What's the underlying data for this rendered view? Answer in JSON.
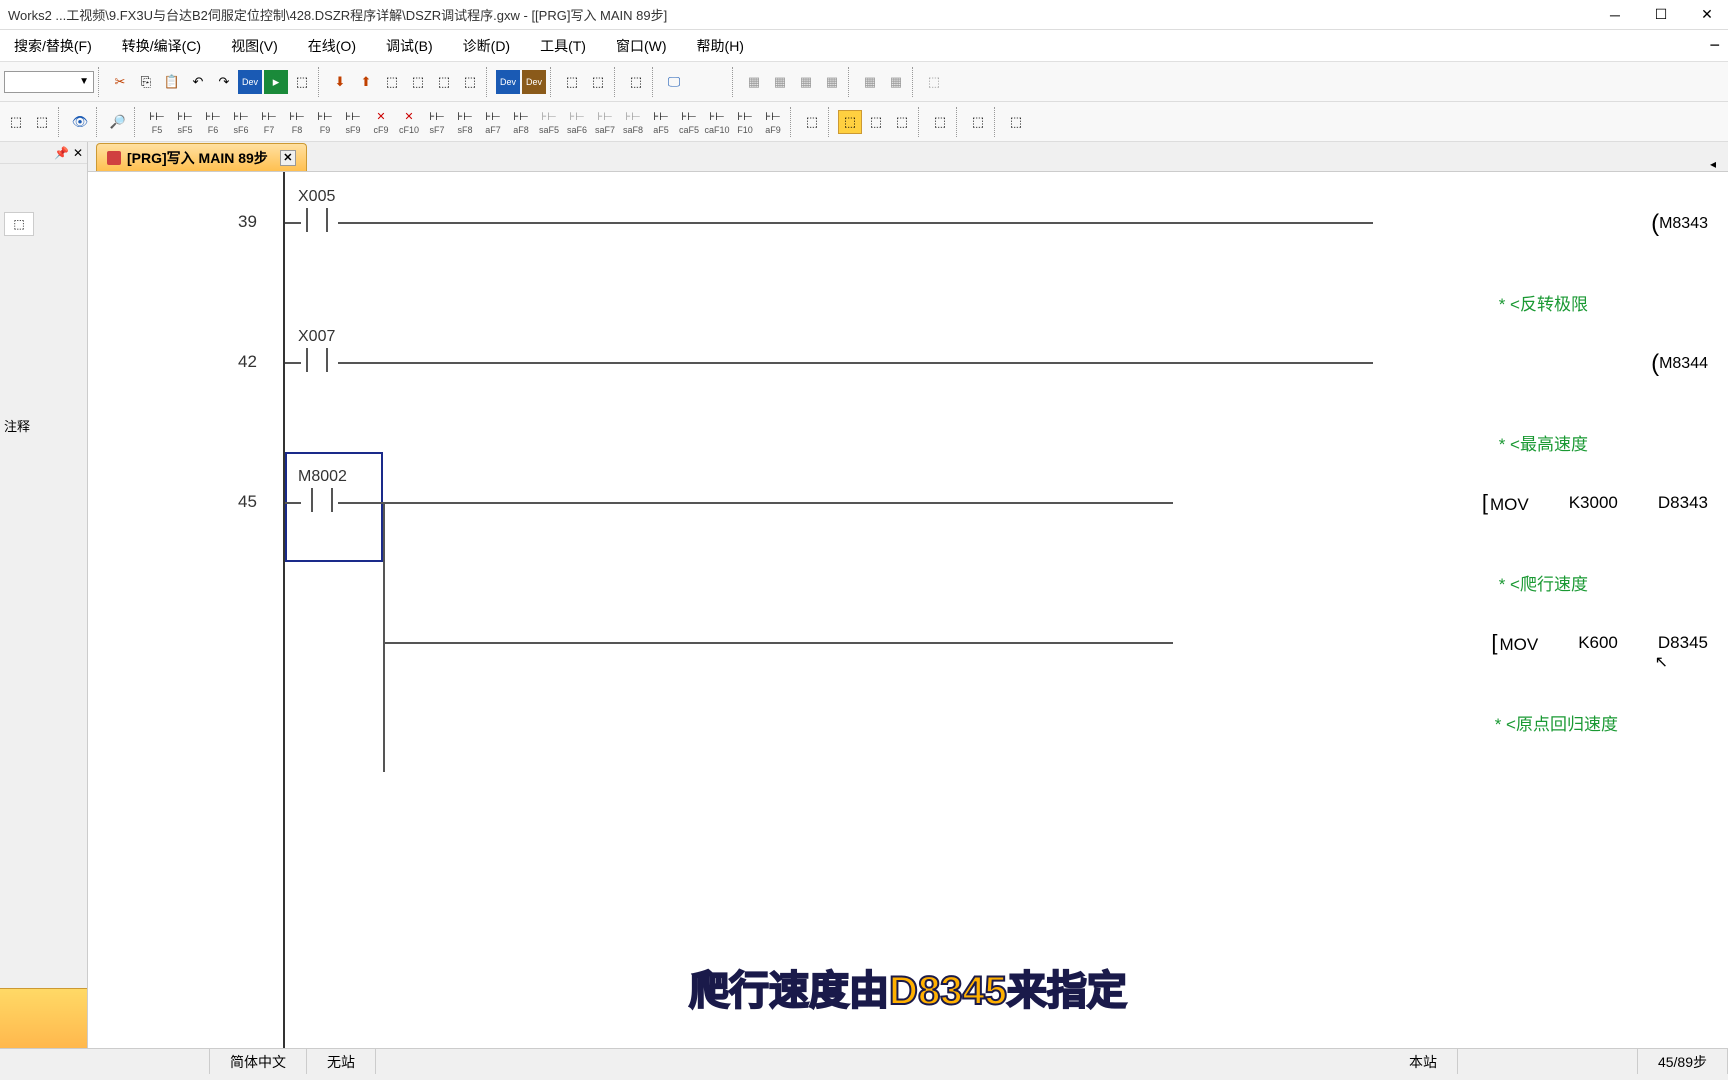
{
  "titlebar": {
    "text": "Works2 ...工视频\\9.FX3U与台达B2伺服定位控制\\428.DSZR程序详解\\DSZR调试程序.gxw - [[PRG]写入 MAIN 89步]"
  },
  "menus": {
    "search": "搜索/替换(F)",
    "convert": "转换/编译(C)",
    "view": "视图(V)",
    "online": "在线(O)",
    "debug": "调试(B)",
    "diagnose": "诊断(D)",
    "tool": "工具(T)",
    "window": "窗口(W)",
    "help": "帮助(H)"
  },
  "tab": {
    "label": "[PRG]写入 MAIN 89步"
  },
  "left_panel": {
    "comment_label": "注释"
  },
  "function_keys": [
    "F5",
    "sF5",
    "F6",
    "sF6",
    "F7",
    "F8",
    "F9",
    "sF9",
    "cF9",
    "cF10",
    "sF7",
    "sF8",
    "aF7",
    "aF8",
    "saF5",
    "saF6",
    "saF7",
    "saF8",
    "aF5",
    "caF5",
    "caF10",
    "F10",
    "aF9"
  ],
  "ladder": {
    "rungs": [
      {
        "step": "39",
        "contact": "X005",
        "coil": "M8343",
        "comment": "* <反转极限"
      },
      {
        "step": "42",
        "contact": "X007",
        "coil": "M8344",
        "comment": "* <最高速度"
      },
      {
        "step": "45",
        "contact": "M8002",
        "instr": {
          "op": "MOV",
          "src": "K3000",
          "dst": "D8343"
        },
        "comment": "* <爬行速度",
        "selected": true
      },
      {
        "step": "",
        "instr": {
          "op": "MOV",
          "src": "K600",
          "dst": "D8345"
        },
        "comment": "* <原点回归速度"
      }
    ]
  },
  "caption": "爬行速度由D8345来指定",
  "statusbar": {
    "lang": "简体中文",
    "station": "无站",
    "local": "本站",
    "pos": "45/89步"
  }
}
